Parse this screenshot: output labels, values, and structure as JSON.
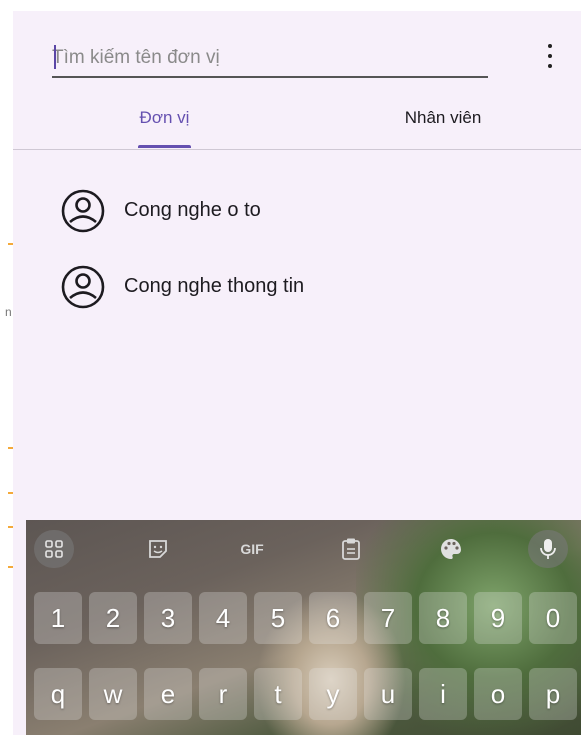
{
  "search": {
    "placeholder": "Tìm kiếm tên đơn vị",
    "value": ""
  },
  "tabs": [
    {
      "label": "Đơn vị",
      "active": true
    },
    {
      "label": "Nhân viên",
      "active": false
    }
  ],
  "units": [
    {
      "name": "Cong nghe o to",
      "icon": "account-circle-icon"
    },
    {
      "name": "Cong nghe thong tin",
      "icon": "account-circle-icon"
    }
  ],
  "left_edge": {
    "letter": "n"
  },
  "keyboard": {
    "toolbar": [
      {
        "name": "apps-grid-icon"
      },
      {
        "name": "sticker-icon"
      },
      {
        "name": "gif-button",
        "label": "GIF"
      },
      {
        "name": "clipboard-icon"
      },
      {
        "name": "palette-icon"
      },
      {
        "name": "microphone-icon"
      }
    ],
    "number_row": [
      "1",
      "2",
      "3",
      "4",
      "5",
      "6",
      "7",
      "8",
      "9",
      "0"
    ],
    "letter_row": [
      "q",
      "w",
      "e",
      "r",
      "t",
      "y",
      "u",
      "i",
      "o",
      "p"
    ]
  },
  "colors": {
    "accent": "#6550b0",
    "panel_bg": "#f7f0fa",
    "text": "#1d1b20"
  }
}
